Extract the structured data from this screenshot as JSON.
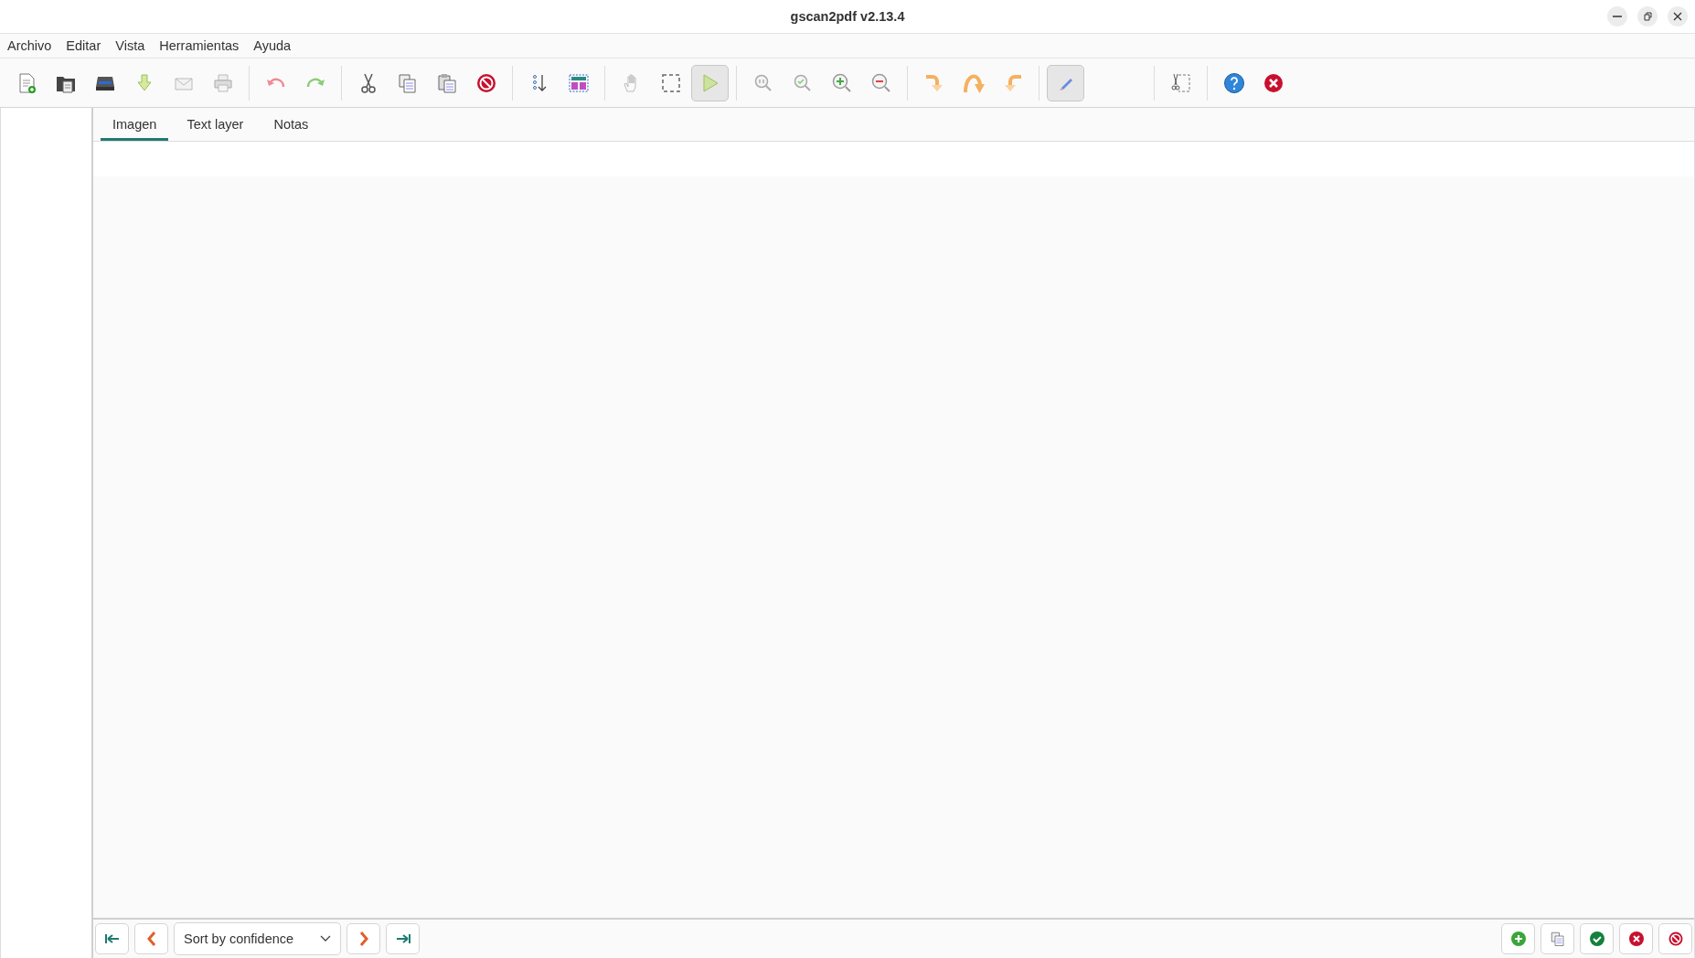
{
  "window": {
    "title": "gscan2pdf v2.13.4"
  },
  "menu": [
    "Archivo",
    "Editar",
    "Vista",
    "Herramientas",
    "Ayuda"
  ],
  "toolbar": {
    "groups": [
      {
        "buttons": [
          {
            "pressed": false
          },
          {
            "pressed": false
          },
          {
            "pressed": false
          },
          {
            "pressed": false
          },
          {
            "pressed": false
          },
          {
            "pressed": false
          }
        ]
      },
      {
        "buttons": [
          {
            "pressed": false
          },
          {
            "pressed": false
          }
        ]
      },
      {
        "buttons": [
          {
            "pressed": false
          },
          {
            "pressed": false
          },
          {
            "pressed": false
          },
          {
            "pressed": false
          }
        ]
      },
      {
        "buttons": [
          {
            "pressed": false
          },
          {
            "pressed": false
          }
        ]
      },
      {
        "buttons": [
          {
            "pressed": false
          },
          {
            "pressed": false
          },
          {
            "pressed": true
          }
        ]
      },
      {
        "buttons": [
          {
            "pressed": false
          },
          {
            "pressed": false
          },
          {
            "pressed": false
          },
          {
            "pressed": false
          }
        ]
      },
      {
        "buttons": [
          {
            "pressed": false
          },
          {
            "pressed": false
          },
          {
            "pressed": false
          }
        ]
      },
      {
        "buttons": [
          {
            "pressed": true
          }
        ]
      },
      {
        "buttons": [
          {
            "pressed": false
          }
        ]
      },
      {
        "buttons": [
          {
            "pressed": false
          },
          {
            "pressed": false
          }
        ]
      }
    ]
  },
  "tabs": [
    {
      "label": "Imagen",
      "selected": true
    },
    {
      "label": "Text layer",
      "selected": false
    },
    {
      "label": "Notas",
      "selected": false
    }
  ],
  "navigation": {
    "sort": {
      "value": "Sort by confidence"
    }
  }
}
